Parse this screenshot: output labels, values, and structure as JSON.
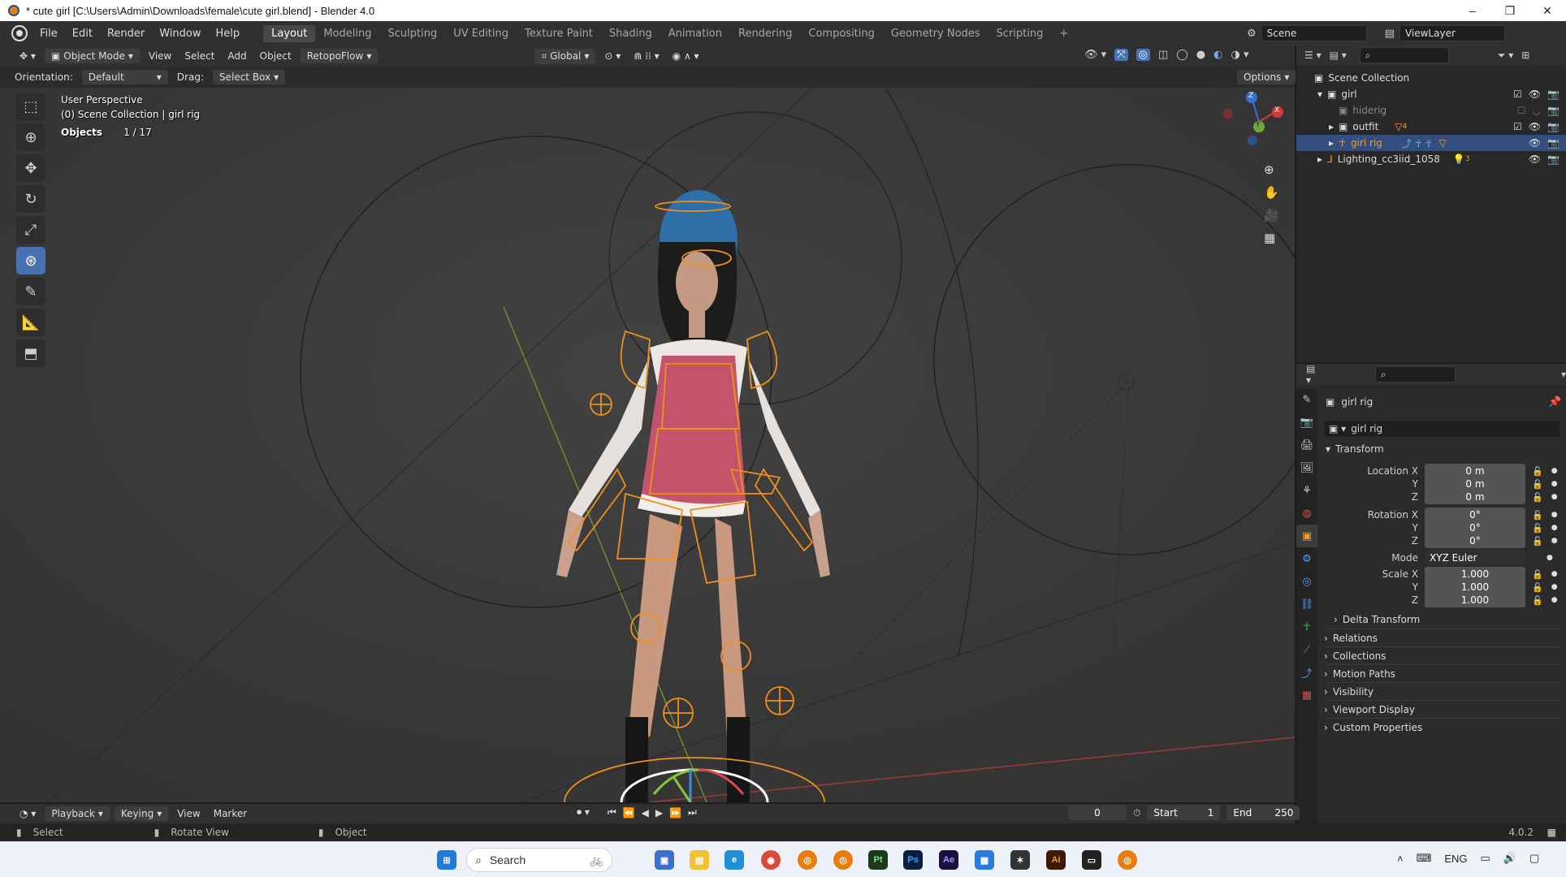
{
  "window": {
    "title": "* cute girl [C:\\Users\\Admin\\Downloads\\female\\cute girl.blend] - Blender 4.0",
    "minimize": "–",
    "maximize": "❐",
    "close": "✕"
  },
  "menu": [
    "File",
    "Edit",
    "Render",
    "Window",
    "Help"
  ],
  "workspaces": [
    "Layout",
    "Modeling",
    "Sculpting",
    "UV Editing",
    "Texture Paint",
    "Shading",
    "Animation",
    "Rendering",
    "Compositing",
    "Geometry Nodes",
    "Scripting"
  ],
  "workspace_add": "+",
  "scene_field": "Scene",
  "viewlayer_field": "ViewLayer",
  "viewport_header": {
    "mode": "Object Mode",
    "menus": [
      "View",
      "Select",
      "Add",
      "Object"
    ],
    "addon": "RetopoFlow",
    "transform_space": "Global"
  },
  "tool_settings": {
    "orientation_label": "Orientation:",
    "orientation_value": "Default",
    "drag_label": "Drag:",
    "drag_value": "Select Box",
    "options": "Options"
  },
  "viewport_info": {
    "perspective": "User Perspective",
    "collection": "(0) Scene Collection | girl rig",
    "objects_label": "Objects",
    "objects_count": "1 / 17"
  },
  "gizmo": {
    "z": "Z",
    "y": "Y",
    "x": "X"
  },
  "outliner": {
    "root": "Scene Collection",
    "items": [
      {
        "label": "girl",
        "level": 1
      },
      {
        "label": "hiderig",
        "level": 2
      },
      {
        "label": "outfit",
        "level": 2,
        "badge": "4"
      },
      {
        "label": "girl rig",
        "level": 2,
        "selected": true
      },
      {
        "label": "Lighting_cc3iid_1058",
        "level": 1,
        "badge": "3"
      }
    ]
  },
  "properties": {
    "object_name": "girl rig",
    "data_name": "girl rig",
    "transform_title": "Transform",
    "location": {
      "label": "Location X",
      "x": "0 m",
      "y": "0 m",
      "z": "0 m"
    },
    "rotation": {
      "label": "Rotation X",
      "x": "0°",
      "y": "0°",
      "z": "0°"
    },
    "mode_label": "Mode",
    "mode_value": "XYZ Euler",
    "scale": {
      "label": "Scale X",
      "x": "1.000",
      "y": "1.000",
      "z": "1.000"
    },
    "axis_y": "Y",
    "axis_z": "Z",
    "sections": [
      "Delta Transform",
      "Relations",
      "Collections",
      "Motion Paths",
      "Visibility",
      "Viewport Display",
      "Custom Properties"
    ]
  },
  "timeline": {
    "menus": [
      "Playback",
      "Keying",
      "View",
      "Marker"
    ],
    "current_frame": "0",
    "start_label": "Start",
    "start_value": "1",
    "end_label": "End",
    "end_value": "250"
  },
  "statusbar": {
    "select": "Select",
    "rotate": "Rotate View",
    "object": "Object",
    "version": "4.0.2"
  },
  "taskbar": {
    "search": "Search",
    "lang": "ENG"
  },
  "colors": {
    "accent": "#4772b3",
    "selection": "#e8850f",
    "header": "#303030",
    "viewport": "#393939"
  }
}
